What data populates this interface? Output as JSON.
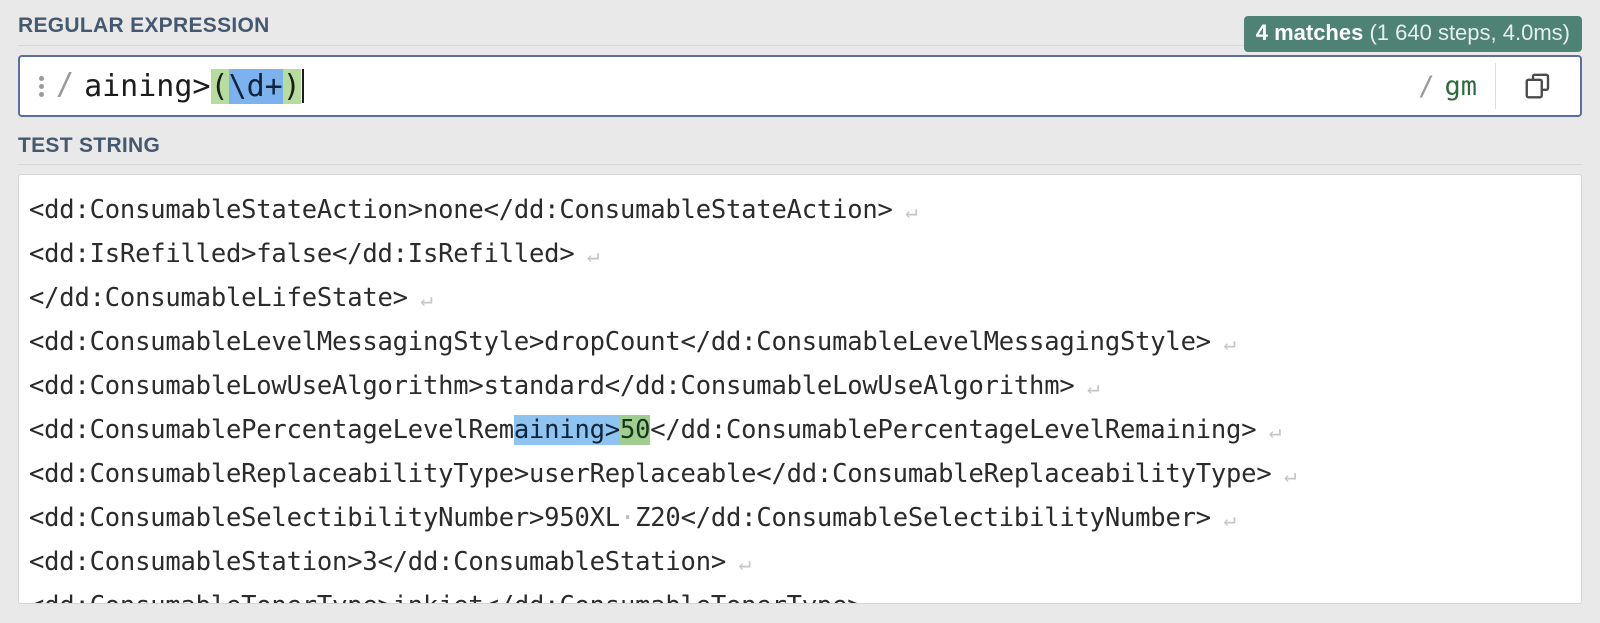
{
  "sections": {
    "regex_label": "REGULAR EXPRESSION",
    "test_label": "TEST STRING"
  },
  "match_badge": {
    "count_text": "4 matches",
    "meta_text": " (1 640 steps, 4.0ms)",
    "bg_color": "#4e8274",
    "text_color": "#ffffff"
  },
  "regex_bar": {
    "kebab_icon": "kebab-menu-icon",
    "open_delimiter": "/",
    "close_delimiter": "/",
    "flags": "gm",
    "copy_icon": "copy-icon",
    "pattern_full": "aining>(\\d+)",
    "tokens": [
      {
        "text": "aining>",
        "style": "plain"
      },
      {
        "text": "(",
        "style": "group-paren"
      },
      {
        "text": "\\d+",
        "style": "class"
      },
      {
        "text": ")",
        "style": "group-paren"
      }
    ],
    "caret_visible": true,
    "colors": {
      "border": "#5a6f9e",
      "group_highlight": "#b6dd9e",
      "class_highlight": "#7cb3ee",
      "flag_text": "#2f6b3e"
    }
  },
  "test_string": {
    "newline_glyph": "↵",
    "space_glyph": "·",
    "match_colors": {
      "match": "#8fc3f0",
      "group": "#9fce90"
    },
    "lines": [
      {
        "segments": [
          {
            "text": "<dd:ConsumableStateAction>none</dd:ConsumableStateAction>",
            "style": "plain"
          }
        ],
        "newline": true
      },
      {
        "segments": [
          {
            "text": "<dd:IsRefilled>false</dd:IsRefilled>",
            "style": "plain"
          }
        ],
        "newline": true
      },
      {
        "segments": [
          {
            "text": "</dd:ConsumableLifeState>",
            "style": "plain"
          }
        ],
        "newline": true
      },
      {
        "segments": [
          {
            "text": "<dd:ConsumableLevelMessagingStyle>dropCount</dd:ConsumableLevelMessagingStyle>",
            "style": "plain"
          }
        ],
        "newline": true
      },
      {
        "segments": [
          {
            "text": "<dd:ConsumableLowUseAlgorithm>standard</dd:ConsumableLowUseAlgorithm>",
            "style": "plain"
          }
        ],
        "newline": true
      },
      {
        "segments": [
          {
            "text": "<dd:ConsumablePercentageLevelRem",
            "style": "plain"
          },
          {
            "text": "aining>",
            "style": "match"
          },
          {
            "text": "50",
            "style": "group"
          },
          {
            "text": "</dd:ConsumablePercentageLevelRemaining>",
            "style": "plain"
          }
        ],
        "newline": true
      },
      {
        "segments": [
          {
            "text": "<dd:ConsumableReplaceabilityType>userReplaceable</dd:ConsumableReplaceabilityType>",
            "style": "plain"
          }
        ],
        "newline": true
      },
      {
        "segments": [
          {
            "text": "<dd:ConsumableSelectibilityNumber>950XL",
            "style": "plain"
          },
          {
            "text": "·",
            "style": "space"
          },
          {
            "text": "Z20</dd:ConsumableSelectibilityNumber>",
            "style": "plain"
          }
        ],
        "newline": true
      },
      {
        "segments": [
          {
            "text": "<dd:ConsumableStation>3</dd:ConsumableStation>",
            "style": "plain"
          }
        ],
        "newline": true
      },
      {
        "segments": [
          {
            "text": "<dd:ConsumableTonerType>inkjet</dd:ConsumableTonerType>",
            "style": "plain"
          }
        ],
        "newline": true
      }
    ]
  }
}
